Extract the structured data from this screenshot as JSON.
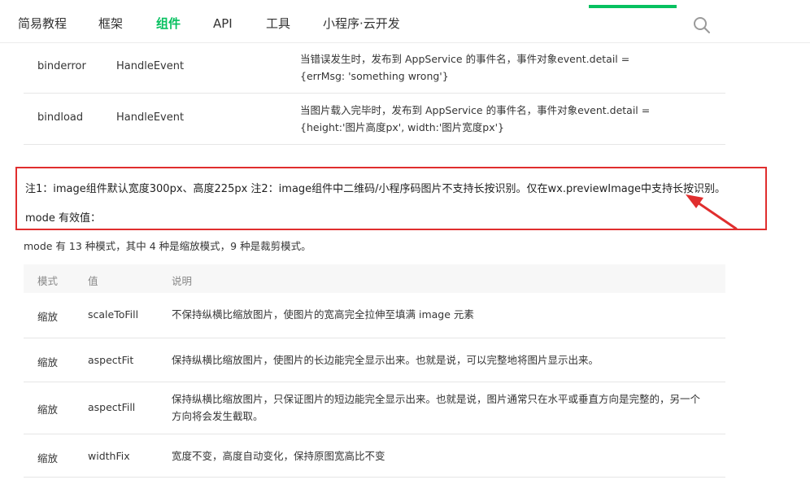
{
  "nav": {
    "items": [
      "简易教程",
      "框架",
      "组件",
      "API",
      "工具",
      "小程序·云开发"
    ],
    "active_index": 2,
    "accent_color": "#07c160",
    "search_icon": "search-icon"
  },
  "events": [
    {
      "name": "binderror",
      "type": "HandleEvent",
      "desc": "当错误发生时，发布到 AppService 的事件名，事件对象event.detail = {errMsg: 'something wrong'}"
    },
    {
      "name": "bindload",
      "type": "HandleEvent",
      "desc": "当图片载入完毕时，发布到 AppService 的事件名，事件对象event.detail = {height:'图片高度px', width:'图片宽度px'}"
    }
  ],
  "note": {
    "line1": "注1：image组件默认宽度300px、高度225px 注2：image组件中二维码/小程序码图片不支持长按识别。仅在wx.previewImage中支持长按识别。",
    "line2": "mode 有效值：",
    "highlight_color": "#e02e2e"
  },
  "mode_intro": "mode 有 13 种模式，其中 4 种是缩放模式，9 种是裁剪模式。",
  "mode_table": {
    "headers": [
      "模式",
      "值",
      "说明"
    ],
    "rows": [
      {
        "mode": "缩放",
        "value": "scaleToFill",
        "desc": "不保持纵横比缩放图片，使图片的宽高完全拉伸至填满 image 元素"
      },
      {
        "mode": "缩放",
        "value": "aspectFit",
        "desc": "保持纵横比缩放图片，使图片的长边能完全显示出来。也就是说，可以完整地将图片显示出来。"
      },
      {
        "mode": "缩放",
        "value": "aspectFill",
        "desc": "保持纵横比缩放图片，只保证图片的短边能完全显示出来。也就是说，图片通常只在水平或垂直方向是完整的，另一个方向将会发生截取。"
      },
      {
        "mode": "缩放",
        "value": "widthFix",
        "desc": "宽度不变，高度自动变化，保持原图宽高比不变"
      }
    ]
  }
}
